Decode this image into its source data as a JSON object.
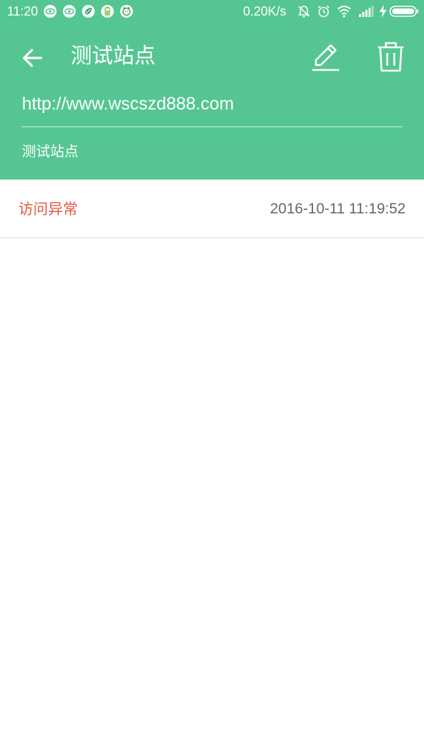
{
  "status_bar": {
    "time": "11:20",
    "network_speed": "0.20K/s",
    "icons": [
      "eye-icon",
      "eye-icon",
      "leaf-icon",
      "battery-saver-icon",
      "cat-icon",
      "alarm-off-icon",
      "alarm-clock-icon",
      "wifi-icon",
      "signal-icon",
      "charging-icon",
      "battery-icon"
    ]
  },
  "toolbar": {
    "title": "测试站点",
    "back_icon": "arrow-left-icon",
    "edit_icon": "pencil-icon",
    "delete_icon": "trash-icon"
  },
  "site": {
    "url": "http://www.wscszd888.com",
    "name": "测试站点"
  },
  "logs": [
    {
      "status": "访问异常",
      "time": "2016-10-11 11:19:52"
    }
  ],
  "colors": {
    "header_bg": "#55c692",
    "error_text": "#e45a3f",
    "time_text": "#666666"
  }
}
